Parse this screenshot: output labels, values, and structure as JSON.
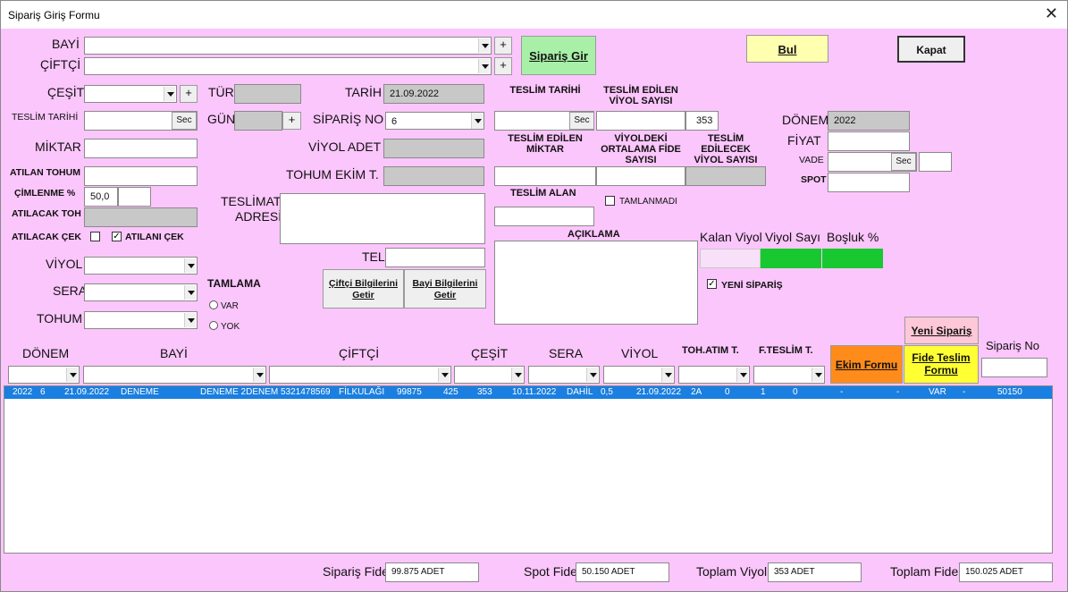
{
  "window": {
    "title": "Sipariş Giriş Formu",
    "close_icon": "✕"
  },
  "labels": {
    "bayi": "BAYİ",
    "ciftci": "ÇİFTÇİ",
    "cesit": "ÇEŞİT",
    "tur": "TÜR",
    "tarih": "TARİH",
    "teslim_tarihi_left": "TESLİM TARİHİ",
    "gun": "GÜN",
    "siparis_no": "SİPARİŞ NO",
    "miktar": "MİKTAR",
    "viyol_adet": "VİYOL ADET",
    "atilan_tohum": "ATILAN TOHUM",
    "tohum_ekim": "TOHUM EKİM T.",
    "cimlenme": "ÇİMLENME %",
    "atilacak_toh": "ATILACAK TOH",
    "teslimat_adresi_1": "TESLİMAT",
    "teslimat_adresi_2": "ADRESİ",
    "atilacak_cek": "ATILACAK ÇEK",
    "atilani_cek": "ATILANI ÇEK",
    "tel": "TEL",
    "viyol": "VİYOL",
    "sera": "SERA",
    "tohum": "TOHUM",
    "tamlama": "TAMLAMA",
    "var": "VAR",
    "yok": "YOK",
    "teslim_tarihi_head": "TESLİM TARİHİ",
    "teslim_edilen_viyol": "TESLİM EDİLEN VİYOL SAYISI",
    "teslim_edilen_miktar": "TESLİM EDİLEN MİKTAR",
    "viyoldeki_ort": "VİYOLDEKİ ORTALAMA FİDE SAYISI",
    "teslim_edilecek": "TESLİM EDİLECEK VİYOL SAYISI",
    "teslim_alan": "TESLİM ALAN",
    "tamlanmadi": "TAMLANMADI",
    "aciklama": "AÇIKLAMA",
    "donem": "DÖNEM",
    "fiyat": "FİYAT",
    "vade": "VADE",
    "spot": "SPOT",
    "kalan_viyol": "Kalan Viyol",
    "viyol_sayi": "Viyol Sayı",
    "bosluk": "Boşluk %",
    "yeni_siparis_chk": "YENİ SİPARİŞ"
  },
  "buttons": {
    "siparis_gir": "Sipariş Gir",
    "bul": "Bul",
    "kapat": "Kapat",
    "plus": "+",
    "sec": "Sec",
    "ciftci_bilgi": "Çiftçi Bilgilerini Getir",
    "bayi_bilgi": "Bayi Bilgilerini Getir",
    "yeni_siparis": "Yeni Sipariş",
    "ekim_formu": "Ekim Formu",
    "fide_teslim": "Fide Teslim Formu"
  },
  "values": {
    "tarih": "21.09.2022",
    "siparis_no": "6",
    "teslim_viyol": "353",
    "donem": "2022",
    "cimlenme": "50,0",
    "check_mark": "✓"
  },
  "filters": {
    "donem": "DÖNEM",
    "bayi": "BAYİ",
    "ciftci": "ÇİFTÇİ",
    "cesit": "ÇEŞİT",
    "sera": "SERA",
    "viyol": "VİYOL",
    "toh_atim": "TOH.ATIM T.",
    "f_teslim": "F.TESLİM T.",
    "siparis_no": "Sipariş No"
  },
  "row": [
    "2022",
    "6",
    "21.09.2022",
    "DENEME",
    "DENEME 2DENEM",
    "5321478569",
    "FİLKULAĞI",
    "99875",
    "425",
    "353",
    "10.11.2022",
    "DAHİL",
    "0,5",
    "21.09.2022",
    "2A",
    "0",
    "1",
    "0",
    "-",
    "-",
    "VAR",
    "-",
    "50150"
  ],
  "footer": {
    "siparis_fide_label": "Sipariş Fide",
    "siparis_fide": "99.875 ADET",
    "spot_fide_label": "Spot Fide",
    "spot_fide": "50.150 ADET",
    "toplam_viyol_label": "Toplam Viyol",
    "toplam_viyol": "353 ADET",
    "toplam_fide_label": "Toplam Fide",
    "toplam_fide": "150.025 ADET"
  },
  "colors": {
    "form_bg": "#fbc6fb",
    "selected_row": "#1a7fe0",
    "bul": "#ffffb0",
    "siparis_gir": "#a8f0a8",
    "ekim_formu": "#ff8c1a",
    "fide_teslim": "#ffff33",
    "green_fill": "#18c830"
  }
}
